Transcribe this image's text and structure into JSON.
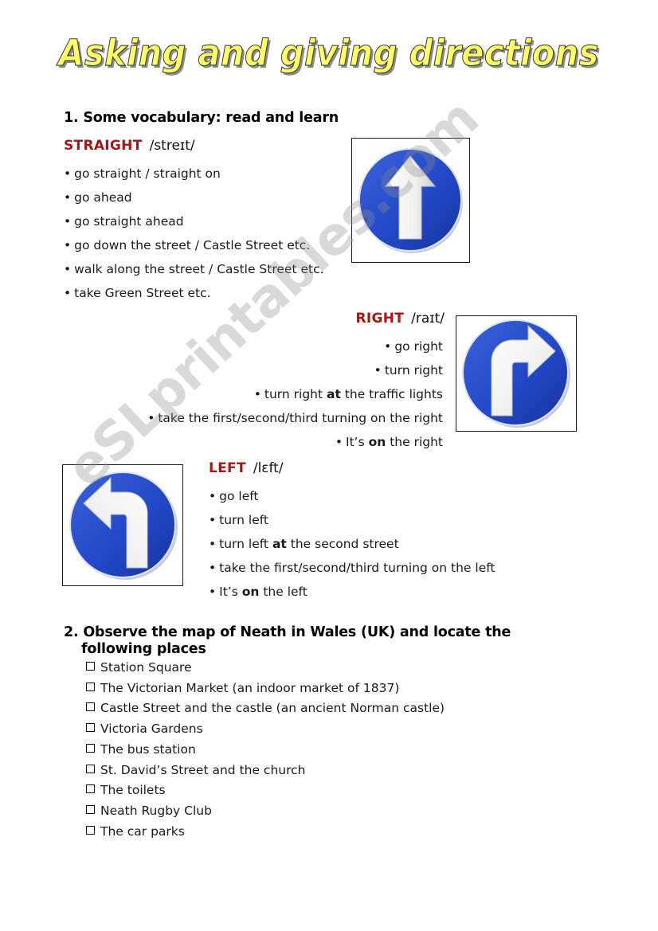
{
  "document": {
    "title": "Asking and giving directions",
    "watermark": "eSLprintables.com"
  },
  "colors": {
    "title_fill": "#ffff66",
    "title_shadow": "#787878",
    "word_heading": "#a01818",
    "sign_blue": "#2248c8",
    "sign_arrow": "#f2f2f2",
    "text": "#1a1a1a"
  },
  "sections": [
    {
      "number_label": "1. Some vocabulary: read and learn"
    },
    {
      "number_label": "2. Observe the map of Neath in Wales (UK) and locate the",
      "number_label_line2": "following places"
    }
  ],
  "vocabulary": {
    "straight": {
      "word": "STRAIGHT",
      "ipa": "/streɪt/",
      "items": [
        "go straight / straight on",
        "go ahead",
        "go straight ahead",
        "go down the street / Castle Street etc.",
        "walk along the street / Castle Street etc.",
        "take Green Street etc."
      ]
    },
    "right": {
      "word": "RIGHT",
      "ipa": "/raɪt/",
      "items": [
        {
          "pre": "go right",
          "bold": "",
          "post": ""
        },
        {
          "pre": "turn right",
          "bold": "",
          "post": ""
        },
        {
          "pre": "turn right ",
          "bold": "at",
          "post": " the traffic lights"
        },
        {
          "pre": "take the first/second/third turning on the right",
          "bold": "",
          "post": ""
        },
        {
          "pre": "It’s ",
          "bold": "on",
          "post": " the right"
        }
      ]
    },
    "left": {
      "word": "LEFT",
      "ipa": "/lɛft/",
      "items": [
        {
          "pre": "go left",
          "bold": "",
          "post": ""
        },
        {
          "pre": "turn left",
          "bold": "",
          "post": ""
        },
        {
          "pre": "turn left ",
          "bold": "at",
          "post": " the second street"
        },
        {
          "pre": "take the first/second/third turning on the left",
          "bold": "",
          "post": ""
        },
        {
          "pre": "It’s ",
          "bold": "on",
          "post": " the left"
        }
      ]
    }
  },
  "places": [
    "Station Square",
    "The Victorian Market (an indoor market of 1837)",
    "Castle Street and the castle (an ancient Norman castle)",
    "Victoria Gardens",
    "The bus station",
    "St. David’s Street and the church",
    "The toilets",
    "Neath Rugby Club",
    "The car parks"
  ],
  "signs": [
    {
      "name": "go-straight-sign",
      "direction": "straight"
    },
    {
      "name": "turn-right-sign",
      "direction": "right"
    },
    {
      "name": "turn-left-sign",
      "direction": "left"
    }
  ],
  "symbols": {
    "bullet": "•",
    "checkbox": ""
  }
}
